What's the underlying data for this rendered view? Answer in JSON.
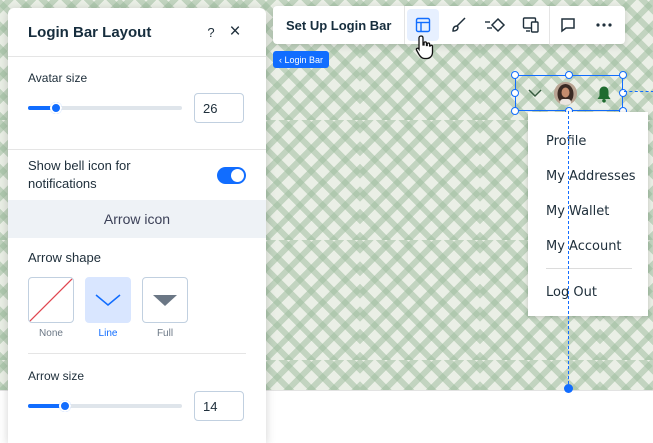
{
  "panel": {
    "title": "Login Bar Layout",
    "help_label": "?",
    "close_label": "×",
    "avatar_size": {
      "label": "Avatar size",
      "value": "26",
      "fraction": 0.18
    },
    "bell_toggle": {
      "label": "Show bell icon for notifications",
      "on": true
    },
    "arrow_icon_section": "Arrow icon",
    "arrow_shape": {
      "label": "Arrow shape",
      "options": [
        {
          "name": "None",
          "selected": false
        },
        {
          "name": "Line",
          "selected": true
        },
        {
          "name": "Full",
          "selected": false
        }
      ]
    },
    "arrow_size": {
      "label": "Arrow size",
      "value": "14",
      "fraction": 0.24
    }
  },
  "toolbar": {
    "title": "Set Up Login Bar",
    "buttons": [
      "layout-icon",
      "design-brush-icon",
      "animation-icon",
      "mobile-desktop-icon",
      "comment-icon",
      "more-icon"
    ]
  },
  "element_tag": "‹ Login Bar",
  "menu": {
    "items": [
      "Profile",
      "My Addresses",
      "My Wallet",
      "My Account"
    ],
    "logout": "Log Out"
  },
  "colors": {
    "accent": "#116dff",
    "bell": "#1f6b2f",
    "canvas": "#eaefe6"
  }
}
